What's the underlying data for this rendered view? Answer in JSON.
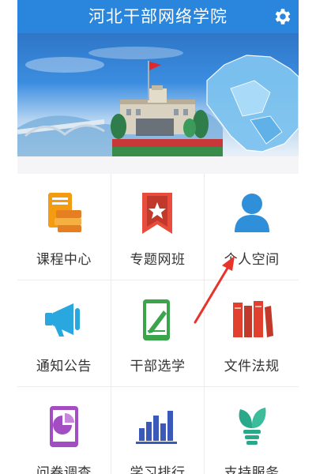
{
  "header": {
    "title": "河北干部网络学院",
    "settings_icon": "gear-icon"
  },
  "banner": {
    "description_icon": "banner-image"
  },
  "menu": [
    {
      "label": "课程中心",
      "icon": "course-book-icon",
      "color": "#f39c12"
    },
    {
      "label": "专题网班",
      "icon": "bookmark-star-icon",
      "color": "#e74c3c"
    },
    {
      "label": "个人空间",
      "icon": "person-icon",
      "color": "#2f8fd8"
    },
    {
      "label": "通知公告",
      "icon": "megaphone-icon",
      "color": "#29a8e0"
    },
    {
      "label": "干部选学",
      "icon": "phone-pen-icon",
      "color": "#3aa54a"
    },
    {
      "label": "文件法规",
      "icon": "books-icon",
      "color": "#e2402f"
    },
    {
      "label": "问卷调查",
      "icon": "survey-chart-icon",
      "color": "#a24ec2"
    },
    {
      "label": "学习排行",
      "icon": "bar-rank-icon",
      "color": "#3b59b8"
    },
    {
      "label": "支持服务",
      "icon": "plant-service-icon",
      "color": "#2aa98a"
    }
  ],
  "accent_color": "#2a86dc",
  "annotation_color": "#e8332b"
}
